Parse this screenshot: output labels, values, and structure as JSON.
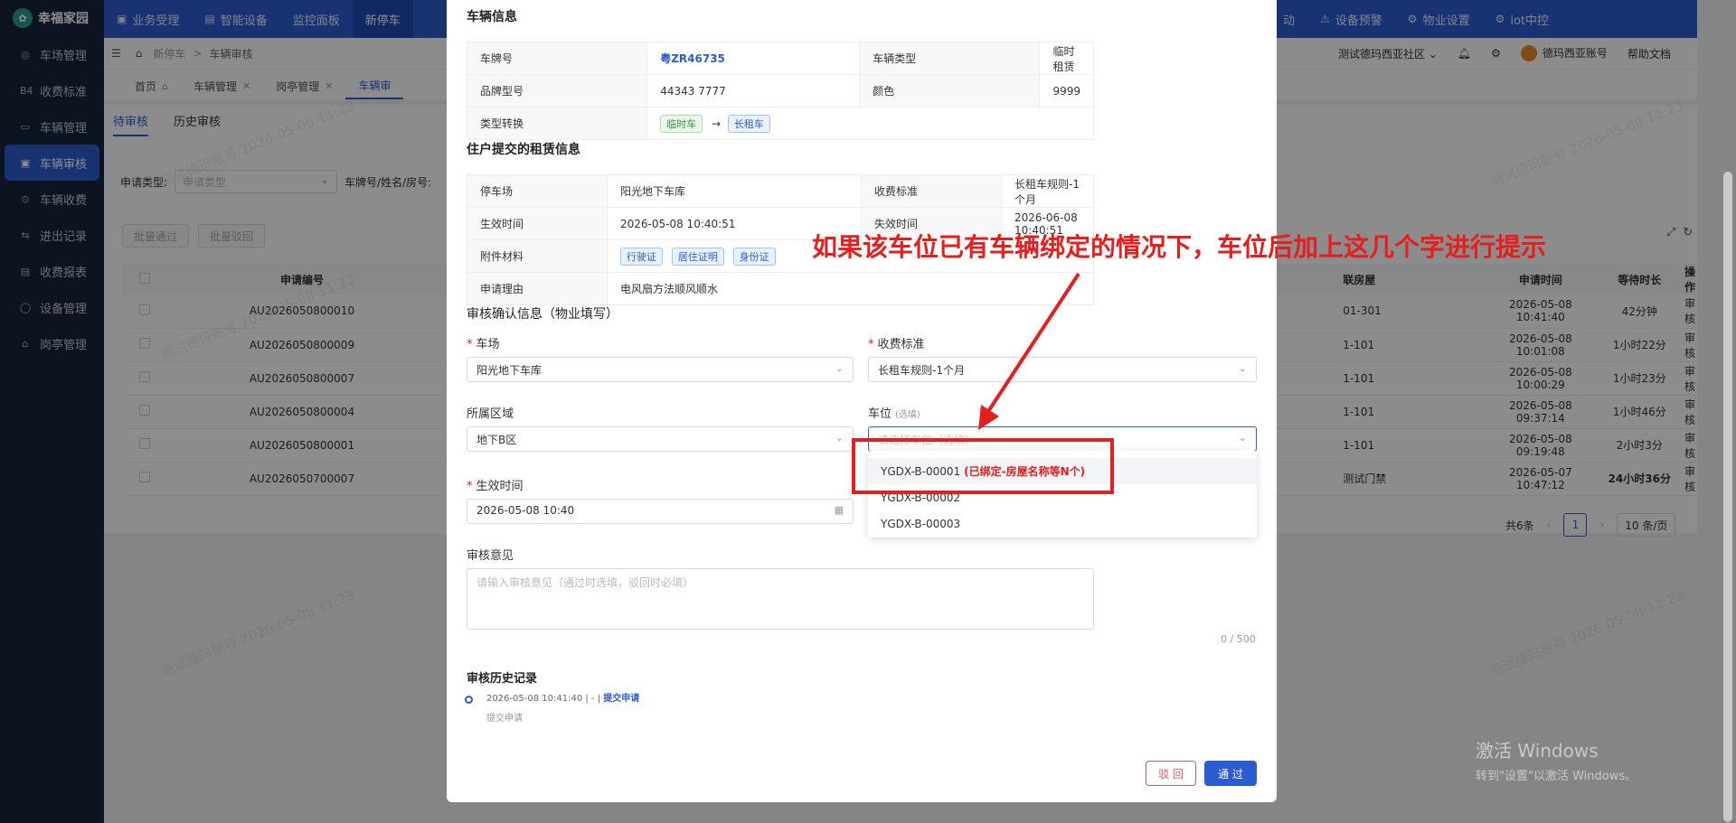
{
  "app": {
    "logo_text": "幸福家园"
  },
  "sidebar": {
    "items": [
      {
        "label": "车场管理",
        "icon": "ring-icon"
      },
      {
        "label": "收费标准",
        "icon": "b4-icon",
        "icon_text": "B4"
      },
      {
        "label": "车辆管理",
        "icon": "car-icon"
      },
      {
        "label": "车辆审核",
        "icon": "audit-icon",
        "active": true
      },
      {
        "label": "车辆收费",
        "icon": "coin-icon"
      },
      {
        "label": "进出记录",
        "icon": "record-icon"
      },
      {
        "label": "收费报表",
        "icon": "report-icon"
      },
      {
        "label": "设备管理",
        "icon": "device-icon"
      },
      {
        "label": "岗亭管理",
        "icon": "booth-icon"
      }
    ]
  },
  "topnav": {
    "items": [
      {
        "label": "业务受理"
      },
      {
        "label": "智能设备"
      },
      {
        "label": "监控面板"
      },
      {
        "label": "新停车",
        "active": true
      }
    ],
    "right_items": [
      {
        "label": "动"
      },
      {
        "label": "设备预警"
      },
      {
        "label": "物业设置"
      },
      {
        "label": "iot中控"
      }
    ]
  },
  "subbar": {
    "breadcrumb": [
      "新停车",
      "车辆审核"
    ],
    "community": "测试德玛西亚社区",
    "account": "德玛西亚账号",
    "help": "帮助文档"
  },
  "tabs": [
    {
      "label": "首页"
    },
    {
      "label": "车辆管理"
    },
    {
      "label": "岗亭管理"
    },
    {
      "label": "车辆审",
      "active": true
    }
  ],
  "review_tabs": {
    "pending": "待审核",
    "history": "历史审核"
  },
  "filters": {
    "type_label": "申请类型:",
    "type_placeholder": "申请类型",
    "search_label": "车牌号/姓名/房号:",
    "batch_pass": "批量通过",
    "batch_reject": "批量驳回"
  },
  "table": {
    "headers": [
      "申请编号",
      "联房屋",
      "申请时间",
      "等待时长",
      "操作"
    ],
    "rows": [
      {
        "id": "AU2026050800010",
        "house": "01-301",
        "time": "2026-05-08 10:41:40",
        "wait": "42分钟",
        "action": "审核",
        "urgent": false
      },
      {
        "id": "AU2026050800009",
        "house": "1-101",
        "time": "2026-05-08 10:01:08",
        "wait": "1小时22分",
        "action": "审核",
        "urgent": false
      },
      {
        "id": "AU2026050800007",
        "house": "1-101",
        "time": "2026-05-08 10:00:29",
        "wait": "1小时23分",
        "action": "审核",
        "urgent": false
      },
      {
        "id": "AU2026050800004",
        "house": "1-101",
        "time": "2026-05-08 09:37:14",
        "wait": "1小时46分",
        "action": "审核",
        "urgent": false
      },
      {
        "id": "AU2026050800001",
        "house": "1-101",
        "time": "2026-05-08 09:19:48",
        "wait": "2小时3分",
        "action": "审核",
        "urgent": false
      },
      {
        "id": "AU2026050700007",
        "house": "测试门禁",
        "time": "2026-05-07 10:47:12",
        "wait": "24小时36分",
        "action": "审核",
        "urgent": true
      }
    ]
  },
  "pager": {
    "total": "共6条",
    "current": "1",
    "size": "10 条/页"
  },
  "watermark_text": "测试德玛账号 2026-05-08 11:23",
  "windows": {
    "line1": "激活 Windows",
    "line2": "转到\"设置\"以激活 Windows。"
  },
  "modal": {
    "vehicle_section": "车辆信息",
    "vehicle": {
      "plate_label": "车牌号",
      "plate": "粤ZR46735",
      "type_label": "车辆类型",
      "type": "临时租赁",
      "model_label": "品牌型号",
      "model": "44343 7777",
      "color_label": "颜色",
      "color": "9999",
      "convert_label": "类型转换",
      "from_tag": "临时车",
      "arrow": "→",
      "to_tag": "长租车"
    },
    "lease_section": "住户提交的租赁信息",
    "lease": {
      "lot_label": "停车场",
      "lot": "阳光地下车库",
      "fee_label": "收费标准",
      "fee": "长租车规则-1个月",
      "start_label": "生效时间",
      "start": "2026-05-08 10:40:51",
      "end_label": "失效时间",
      "end": "2026-06-08 10:40:51",
      "attach_label": "附件材料",
      "attachments": [
        "行驶证",
        "居住证明",
        "身份证"
      ],
      "reason_label": "申请理由",
      "reason": "电风扇方法顺风顺水"
    },
    "confirm_section": "审核确认信息（物业填写）",
    "form": {
      "lot_label": "车场",
      "lot_value": "阳光地下车库",
      "fee_label": "收费标准",
      "fee_value": "长租车规则-1个月",
      "area_label": "所属区域",
      "area_value": "地下B区",
      "space_label": "车位",
      "space_optional": "(选填)",
      "space_placeholder": "请选择车位（选填）",
      "start_label": "生效时间",
      "start_value": "2026-05-08 10:40",
      "opinion_label": "审核意见",
      "opinion_placeholder": "请输入审核意见（通过时选填，驳回时必填）",
      "counter": "0 / 500"
    },
    "dropdown": {
      "options": [
        {
          "label": "YGDX-B-00001",
          "note": "(已绑定-房屋名称等N个)"
        },
        {
          "label": "YGDX-B-00002",
          "note": ""
        },
        {
          "label": "YGDX-B-00003",
          "note": ""
        }
      ]
    },
    "history": {
      "title": "审核历史记录",
      "entry_meta": "2026-05-08 10:41:40 | - |",
      "entry_action": "提交申请",
      "entry_desc": "提交申请"
    },
    "buttons": {
      "reject": "驳 回",
      "pass": "通 过"
    }
  },
  "annotation": {
    "text": "如果该车位已有车辆绑定的情况下，车位后加上这几个字进行提示"
  },
  "colors": {
    "brand": "#2d5bd0",
    "sidebar": "#17233d",
    "annotation": "#e51e1e"
  }
}
